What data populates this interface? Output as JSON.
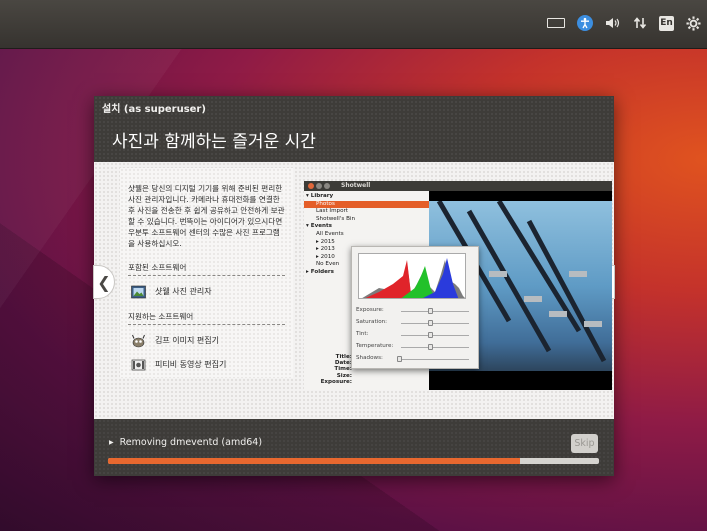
{
  "window": {
    "title": "설치 (as superuser)",
    "heading": "사진과 함께하는 즐거운 시간"
  },
  "topbar": {
    "indicators": [
      "keyboard-icon",
      "accessibility-icon",
      "volume-icon",
      "network-icon",
      "language-indicator",
      "power-gear-icon"
    ],
    "language": "En"
  },
  "slide": {
    "description": "샷웰은 당신의 디지털 기기를 위해 준비된 편리한 사진 관리자입니다. 카메라나 휴대전화를 연결한 후 사진을 전송한 후 쉽게 공유하고 안전하게 보관할 수 있습니다. 번뜩이는 아이디어가 있으시다면 우분투 소프트웨어 센터의 수많은 사진 프로그램을 사용하십시오.",
    "included_label": "포함된 소프트웨어",
    "included": [
      {
        "name": "샷웰 사진 관리자",
        "icon": "shotwell-icon"
      }
    ],
    "supported_label": "지원하는 소프트웨어",
    "supported": [
      {
        "name": "김프 이미지 편집기",
        "icon": "gimp-icon"
      },
      {
        "name": "피티비 동영상 편집기",
        "icon": "pitivi-icon"
      }
    ],
    "prev": "❮",
    "next": "❯",
    "screenshot": {
      "app_title": "Shotwell",
      "tree": [
        {
          "label": "▾ Library",
          "bold": true
        },
        {
          "label": "Photos",
          "selected": true
        },
        {
          "label": "Last Import"
        },
        {
          "label": "Shotwell's Bin"
        },
        {
          "label": "▾ Events",
          "bold": true
        },
        {
          "label": "All Events"
        },
        {
          "label": "▸ 2015"
        },
        {
          "label": "▸ 2013"
        },
        {
          "label": "▸ 2010"
        },
        {
          "label": "No Even"
        },
        {
          "label": "▸ Folders",
          "bold": true
        }
      ],
      "info": [
        "Title:",
        "Date:",
        "Time:",
        "Size:",
        "Exposure:"
      ],
      "adjustments": [
        "Exposure:",
        "Saturation:",
        "Tint:",
        "Temperature:",
        "Shadows:"
      ]
    }
  },
  "footer": {
    "status": "Removing dmeventd (amd64)",
    "skip_label": "Skip",
    "progress_percent": 84
  },
  "colors": {
    "accent": "#e8682f",
    "header_bg": "#3e3c39"
  }
}
